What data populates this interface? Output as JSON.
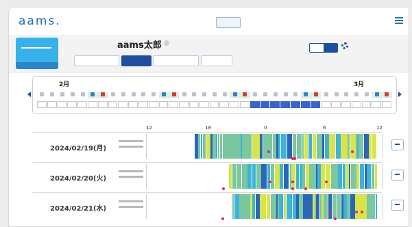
{
  "header": {
    "logo": "aams.",
    "user": ""
  },
  "profile": {
    "name": "aams太郎"
  },
  "calendar": {
    "months": [
      "2月",
      "3月"
    ],
    "days_count": 35,
    "selected_dates": 7
  },
  "timeline": {
    "ticks": [
      "12",
      "18",
      "0",
      "6",
      "12"
    ]
  },
  "rows": [
    {
      "date": "2024/02/19(月)"
    },
    {
      "date": "2024/02/20(火)"
    },
    {
      "date": "2024/02/21(水)"
    }
  ],
  "colors": {
    "blue": "#2b66b8",
    "cyan": "#3eb3d8",
    "yellow": "#d8e54a",
    "green": "#7ac7a0",
    "pink": "#e1207c"
  }
}
